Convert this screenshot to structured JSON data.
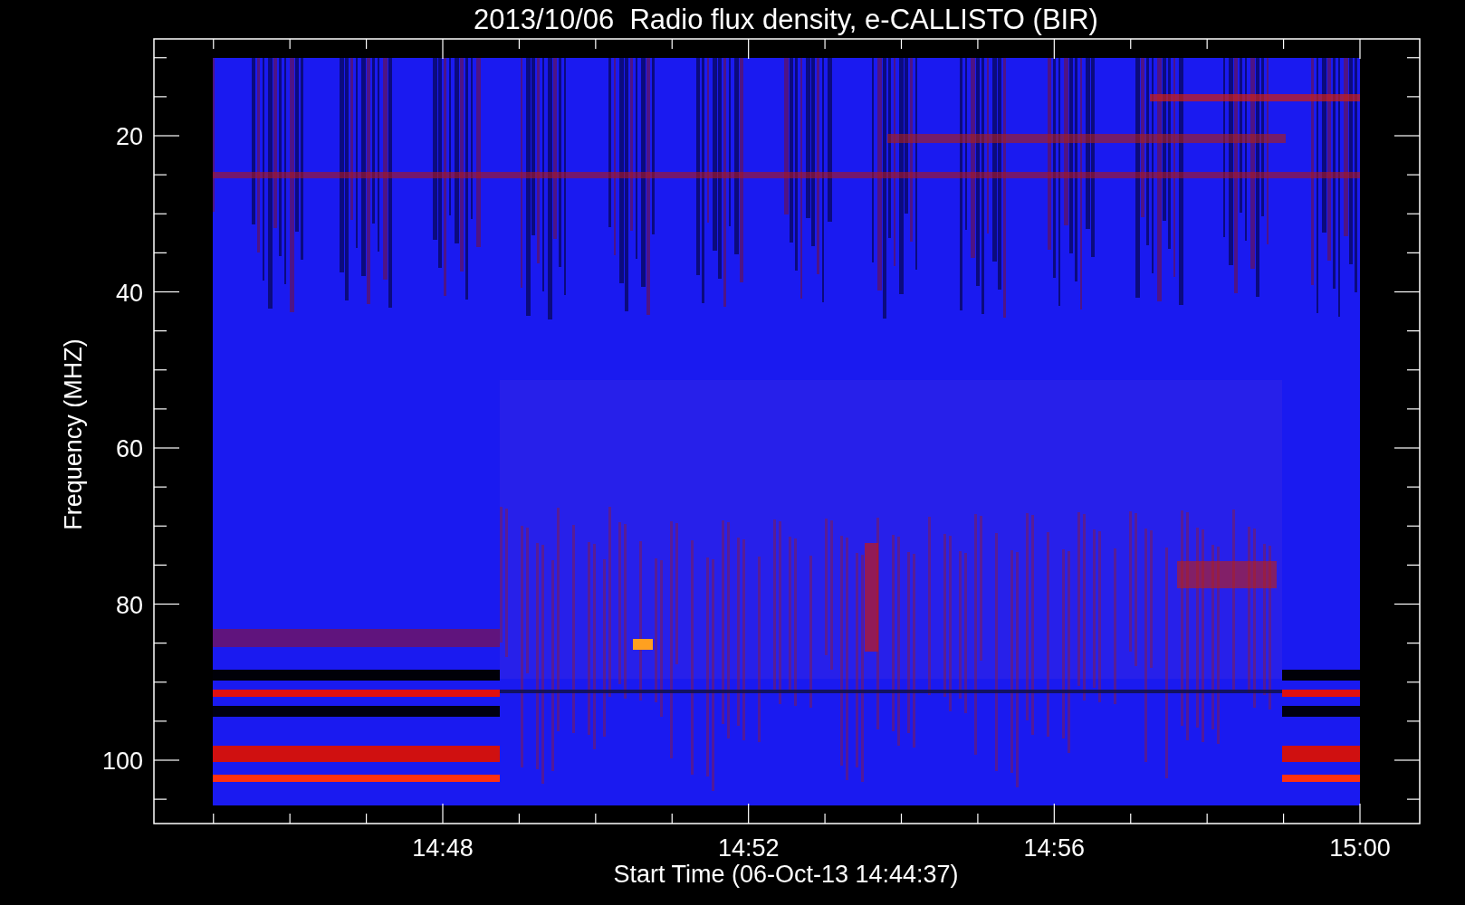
{
  "plot": {
    "title": "2013/10/06  Radio flux density, e-CALLISTO (BIR)",
    "xlabel": "Start Time (06-Oct-13 14:44:37)",
    "ylabel": "Frequency (MHZ)",
    "xticks": [
      "14:48",
      "14:52",
      "14:56",
      "15:00"
    ],
    "yticks": [
      "20",
      "40",
      "60",
      "80",
      "100"
    ]
  }
}
